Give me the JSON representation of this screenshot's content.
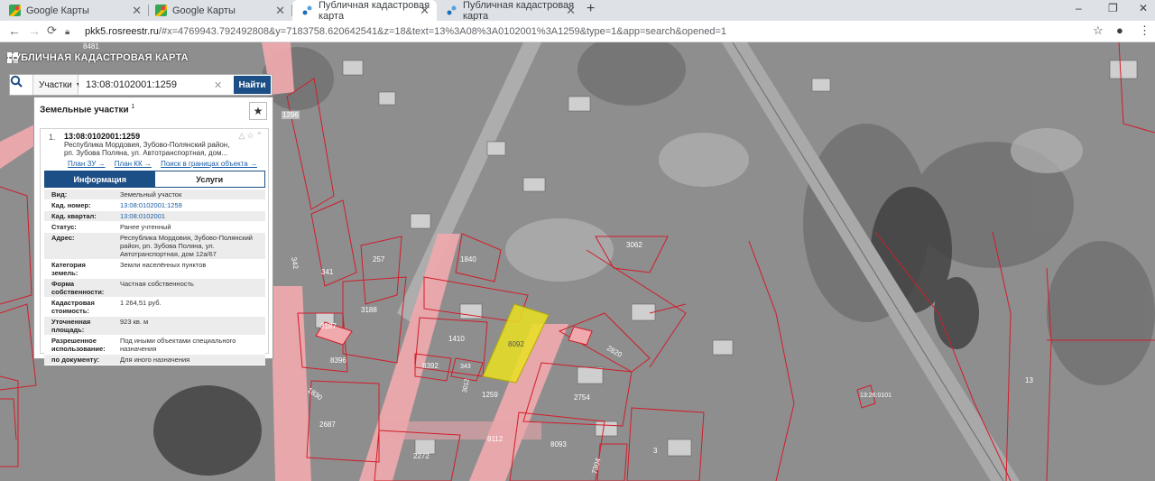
{
  "browser": {
    "tabs": [
      {
        "title": "Google Карты",
        "active": false
      },
      {
        "title": "Google Карты",
        "active": false
      },
      {
        "title": "Публичная кадастровая карта",
        "active": true
      },
      {
        "title": "Публичная кадастровая карта",
        "active": false
      }
    ],
    "new_tab": "+",
    "controls": {
      "minimize": "–",
      "maximize": "❐",
      "close": "✕"
    },
    "url_host": "pkk5.rosreestr.ru",
    "url_rest": "/#x=4769943.792492808&y=7183758.620642541&z=18&text=13%3A08%3A0102001%3A1259&type=1&app=search&opened=1"
  },
  "map": {
    "title": "ПУБЛИЧНАЯ КАДАСТРОВАЯ КАРТА",
    "parcel_labels": [
      "8481",
      "1296",
      "342",
      "257",
      "1840",
      "3062",
      "341",
      "3188",
      "3187",
      "8396",
      "1830",
      "1410",
      "8392",
      "343",
      "1259",
      "8092",
      "3012",
      "2820",
      "2754",
      "2687",
      "2272",
      "8093",
      "8112",
      "7304",
      "3",
      "13",
      "13:26:0101"
    ],
    "selected_parcel": "1259"
  },
  "search": {
    "type_label": "Участки",
    "value": "13:08:0102001:1259",
    "find_label": "Найти"
  },
  "results": {
    "title": "Земельные участки",
    "count_sup": "1",
    "item": {
      "index": "1.",
      "cad_number": "13:08:0102001:1259",
      "address_lines": [
        "Республика Мордовия, Зубово-Полянский район,",
        "рп. Зубова Поляна, ул. Автотранспортная, дом..."
      ],
      "links": [
        "План ЗУ →",
        "План КК →",
        "Поиск в границах объекта →"
      ],
      "tabs": [
        "Информация",
        "Услуги"
      ],
      "fields": [
        {
          "k": "Вид:",
          "v": "Земельный участок",
          "link": false
        },
        {
          "k": "Кад. номер:",
          "v": "13:08:0102001:1259",
          "link": true
        },
        {
          "k": "Кад. квартал:",
          "v": "13:08:0102001",
          "link": true
        },
        {
          "k": "Статус:",
          "v": "Ранее учтенный",
          "link": false
        },
        {
          "k": "Адрес:",
          "v": "Республика Мордовия, Зубово-Полянский район, рп. Зубова Поляна, ул. Автотранспортная, дом 12а/67",
          "link": false
        },
        {
          "k": "Категория земель:",
          "v": "Земли населённых пунктов",
          "link": false
        },
        {
          "k": "Форма собственности:",
          "v": "Частная собственность",
          "link": false
        },
        {
          "k": "Кадастровая стоимость:",
          "v": "1 264,51 руб.",
          "link": false
        },
        {
          "k": "Уточненная площадь:",
          "v": "923 кв. м",
          "link": false
        },
        {
          "k": "Разрешенное использование:",
          "v": "Под иными объектами специального назначения",
          "link": false
        },
        {
          "k": "по документу:",
          "v": "Для иного назначения",
          "link": false
        }
      ]
    }
  }
}
